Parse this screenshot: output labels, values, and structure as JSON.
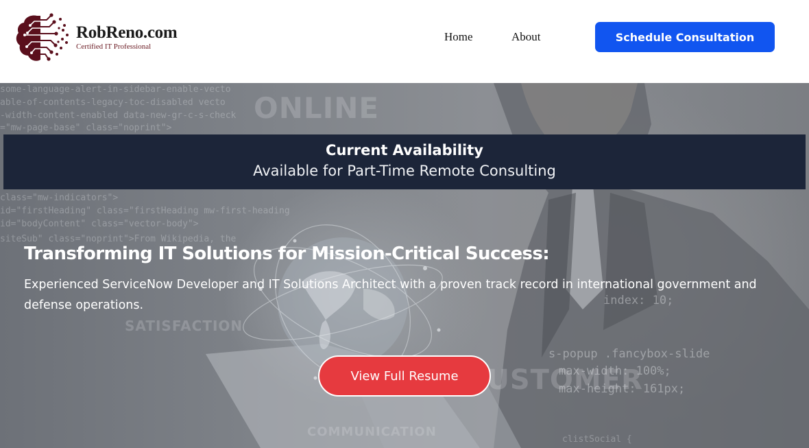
{
  "header": {
    "logo_title": "RobReno.com",
    "logo_subtitle": "Certified IT Professional",
    "logo_icon": "brain-circuit-icon",
    "nav": [
      {
        "label": "Home"
      },
      {
        "label": "About"
      }
    ],
    "cta_label": "Schedule Consultation"
  },
  "availability": {
    "title": "Current Availability",
    "text": "Available for Part-Time Remote Consulting"
  },
  "hero": {
    "heading": "Transforming IT Solutions for Mission-Critical Success:",
    "description": "Experienced ServiceNow Developer and IT Solutions Architect with a proven track record in international government and defense operations.",
    "button_label": "View Full Resume"
  },
  "colors": {
    "accent_blue": "#1155f0",
    "banner_navy": "#1c2539",
    "button_red": "#e63a3f",
    "logo_maroon": "#5a0f1c"
  }
}
